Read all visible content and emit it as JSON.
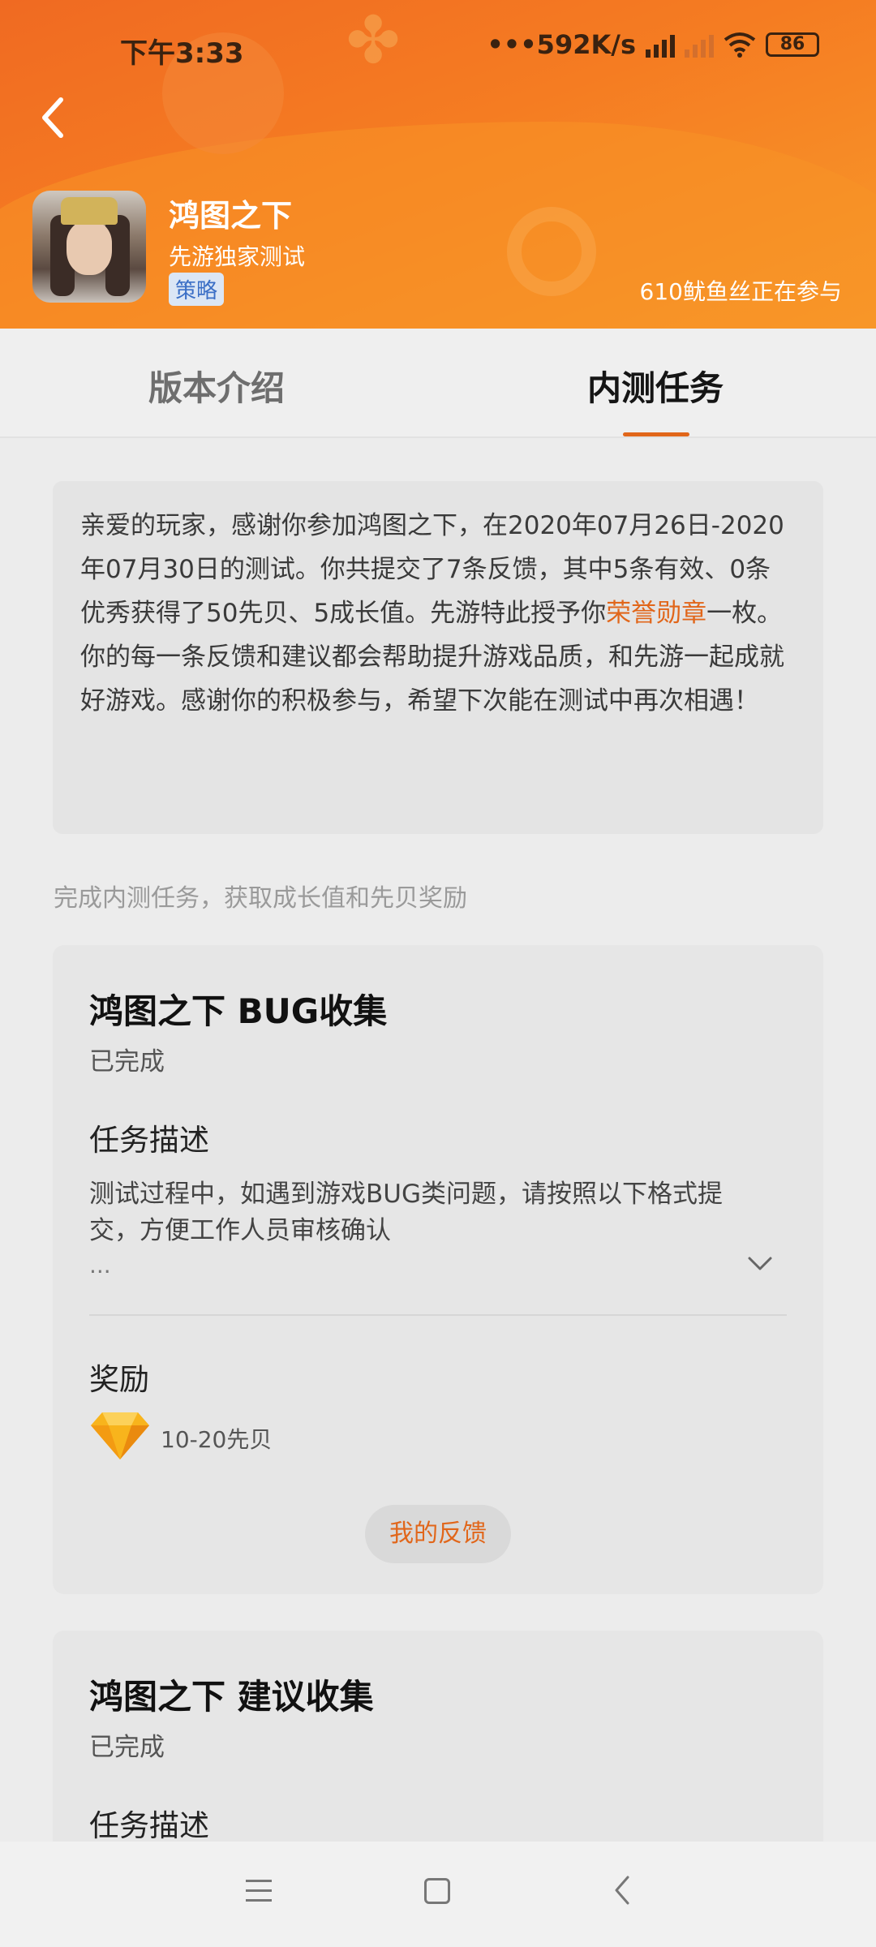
{
  "status_bar": {
    "time": "下午3:33",
    "network_speed": "•••592K/s",
    "battery": "86"
  },
  "header": {
    "game_name": "鸿图之下",
    "subtitle": "先游独家测试",
    "tag": "策略",
    "participants": "610鱿鱼丝正在参与",
    "accent_color": "#f57c22"
  },
  "tabs": [
    {
      "label": "版本介绍",
      "active": false
    },
    {
      "label": "内测任务",
      "active": true
    }
  ],
  "summary": {
    "text_before": "亲爱的玩家，感谢你参加鸿图之下，在2020年07月26日-2020年07月30日的测试。你共提交了7条反馈，其中5条有效、0条优秀获得了50先贝、5成长值。先游特此授予你",
    "highlight": "荣誉勋章",
    "text_after": "一枚。",
    "paragraph2": "你的每一条反馈和建议都会帮助提升游戏品质，和先游一起成就好游戏。感谢你的积极参与，希望下次能在测试中再次相遇！",
    "highlight_color": "#e1661a"
  },
  "section_hint": "完成内测任务，获取成长值和先贝奖励",
  "tasks": [
    {
      "title": "鸿图之下 BUG收集",
      "status": "已完成",
      "desc_label": "任务描述",
      "desc_text": "测试过程中，如遇到游戏BUG类问题，请按照以下格式提交，方便工作人员审核确认",
      "desc_more": "...",
      "reward_label": "奖励",
      "reward_text": "10-20先贝",
      "reward_icon": "gem-icon",
      "button_label": "我的反馈"
    },
    {
      "title": "鸿图之下 建议收集",
      "status": "已完成",
      "desc_label": "任务描述"
    }
  ]
}
